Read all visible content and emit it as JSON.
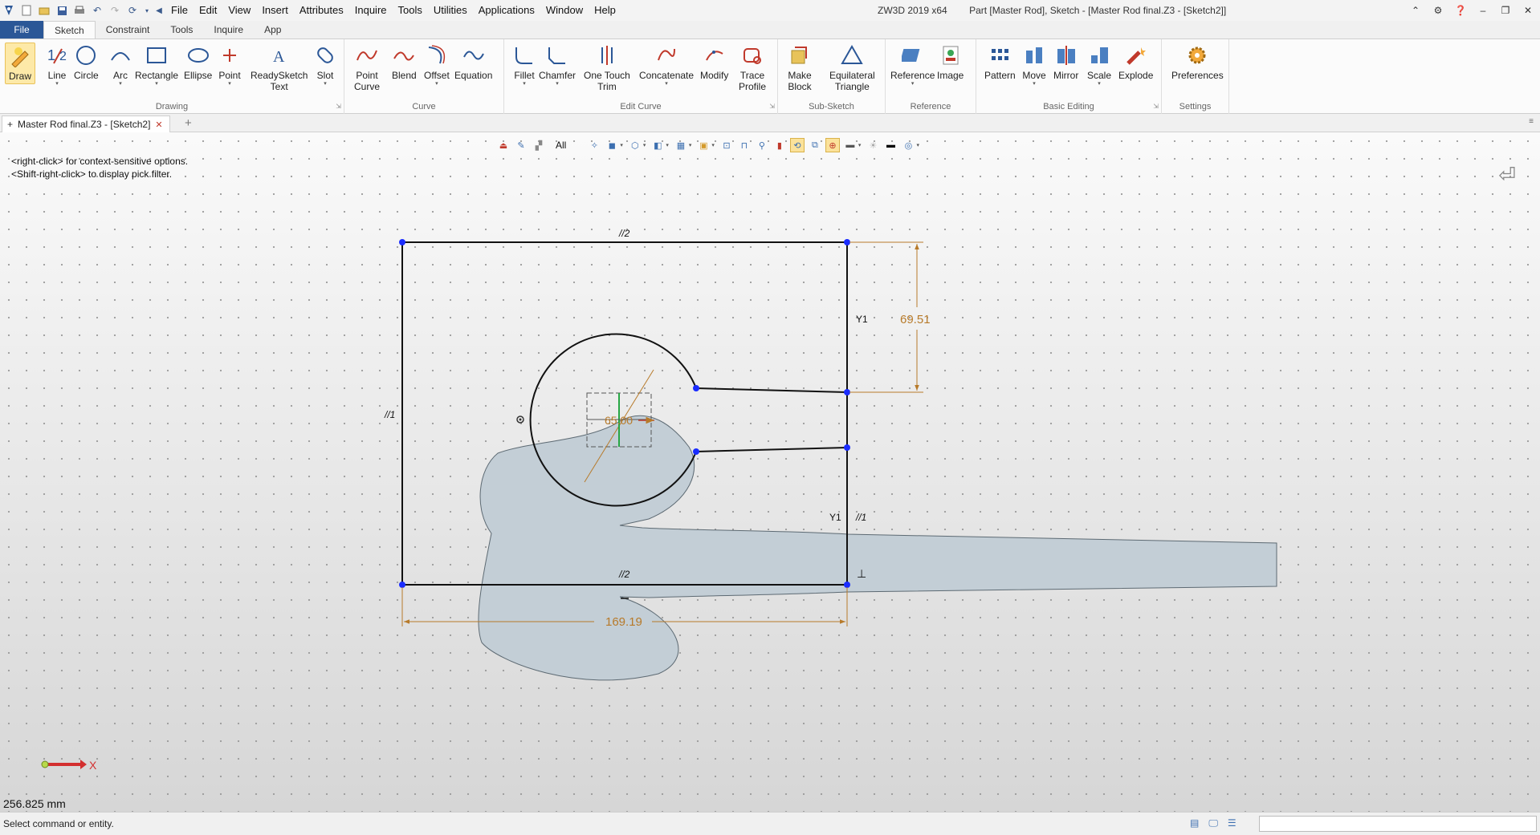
{
  "title": {
    "app": "ZW3D 2019  x64",
    "document": "Part [Master Rod],  Sketch - [Master Rod final.Z3 - [Sketch2]]"
  },
  "menu": [
    "File",
    "Edit",
    "View",
    "Insert",
    "Attributes",
    "Inquire",
    "Tools",
    "Utilities",
    "Applications",
    "Window",
    "Help"
  ],
  "tabs": [
    "File",
    "Sketch",
    "Constraint",
    "Tools",
    "Inquire",
    "App"
  ],
  "active_tab": "Sketch",
  "ribbon": {
    "groups": [
      {
        "name": "drawing",
        "label": "Drawing"
      },
      {
        "name": "curve",
        "label": "Curve"
      },
      {
        "name": "edit-curve",
        "label": "Edit Curve"
      },
      {
        "name": "sub-sketch",
        "label": "Sub-Sketch"
      },
      {
        "name": "reference",
        "label": "Reference"
      },
      {
        "name": "basic-editing",
        "label": "Basic Editing"
      },
      {
        "name": "settings",
        "label": "Settings"
      }
    ],
    "buttons": {
      "draw": "Draw",
      "line": "Line",
      "circle": "Circle",
      "arc": "Arc",
      "rectangle": "Rectangle",
      "ellipse": "Ellipse",
      "point": "Point",
      "readysketch_1": "ReadySketch",
      "readysketch_2": "Text",
      "slot": "Slot",
      "point_curve_1": "Point",
      "point_curve_2": "Curve",
      "blend": "Blend",
      "offset": "Offset",
      "equation": "Equation",
      "fillet": "Fillet",
      "chamfer": "Chamfer",
      "one_touch_1": "One Touch",
      "one_touch_2": "Trim",
      "concatenate": "Concatenate",
      "modify": "Modify",
      "trace_1": "Trace",
      "trace_2": "Profile",
      "make_block_1": "Make",
      "make_block_2": "Block",
      "eq_tri_1": "Equilateral",
      "eq_tri_2": "Triangle",
      "reference": "Reference",
      "image": "Image",
      "pattern": "Pattern",
      "move": "Move",
      "mirror": "Mirror",
      "scale": "Scale",
      "explode": "Explode",
      "preferences": "Preferences"
    }
  },
  "doc_tab": {
    "label": "Master Rod final.Z3 - [Sketch2]"
  },
  "view_toolbar": {
    "filter": "All"
  },
  "hints": {
    "line1": "<right-click> for context-sensitive options.",
    "line2": "<Shift-right-click> to display pick filter."
  },
  "dimensions": {
    "height": "69.51",
    "diameter": "65.00",
    "width": "169.19"
  },
  "constraint_labels": {
    "parallel_2": "//2",
    "parallel_1": "//1",
    "perp_1": "Y1"
  },
  "axis": {
    "x_label": "X"
  },
  "scale_readout": "256.825 mm",
  "status": {
    "text": "Select command or entity."
  },
  "colors": {
    "accent": "#2b5797",
    "profile_fill": "#c3ced6",
    "dimension": "#b77a2a",
    "point": "#1a2cff"
  }
}
